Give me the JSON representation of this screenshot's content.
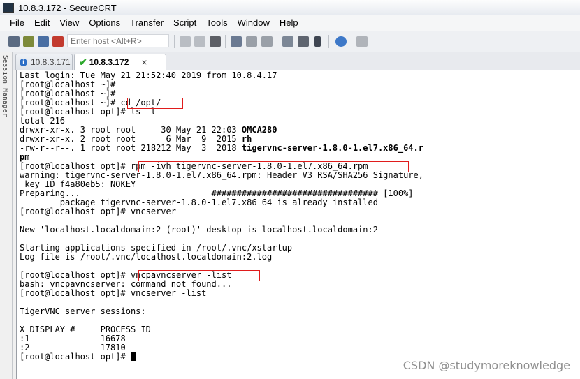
{
  "window": {
    "title": "10.8.3.172 - SecureCRT"
  },
  "menu": [
    "File",
    "Edit",
    "View",
    "Options",
    "Transfer",
    "Script",
    "Tools",
    "Window",
    "Help"
  ],
  "toolbar": {
    "host_placeholder": "Enter host <Alt+R>"
  },
  "session_manager_label": "Session Manager",
  "tabs": [
    {
      "label": "10.8.3.171",
      "active": false,
      "icon": "info-icon"
    },
    {
      "label": "10.8.3.172",
      "active": true,
      "icon": "check-icon",
      "close": "×"
    }
  ],
  "terminal": {
    "lines": [
      "Last login: Tue May 21 21:52:40 2019 from 10.8.4.17",
      "[root@localhost ~]#",
      "[root@localhost ~]#",
      "[root@localhost ~]# cd /opt/",
      "[root@localhost opt]# ls -l",
      "total 216",
      "drwxr-xr-x. 3 root root     30 May 21 22:03 ",
      "drwxr-xr-x. 2 root root      6 Mar  9  2015 ",
      "-rw-r--r--. 1 root root 218212 May  3  2018 ",
      "",
      "[root@localhost opt]# rpm -ivh tigervnc-server-1.8.0-1.el7.x86_64.rpm",
      "warning: tigervnc-server-1.8.0-1.el7.x86_64.rpm: Header V3 RSA/SHA256 Signature,",
      " key ID f4a80eb5: NOKEY",
      "Preparing...                          ################################# [100%]",
      "        package tigervnc-server-1.8.0-1.el7.x86_64 is already installed",
      "[root@localhost opt]# vncserver",
      "",
      "New 'localhost.localdomain:2 (root)' desktop is localhost.localdomain:2",
      "",
      "Starting applications specified in /root/.vnc/xstartup",
      "Log file is /root/.vnc/localhost.localdomain:2.log",
      "",
      "[root@localhost opt]# vncpavncserver -list",
      "bash: vncpavncserver: command not found...",
      "[root@localhost opt]# vncserver -list",
      "",
      "TigerVNC server sessions:",
      "",
      "X DISPLAY #     PROCESS ID",
      ":1              16678",
      ":2              17810",
      "[root@localhost opt]# "
    ],
    "bold_names": [
      "OMCA280",
      "rh",
      "tigervnc-server-1.8.0-1.el7.x86_64.r",
      "pm"
    ]
  },
  "watermark": "CSDN @studymoreknowledge"
}
